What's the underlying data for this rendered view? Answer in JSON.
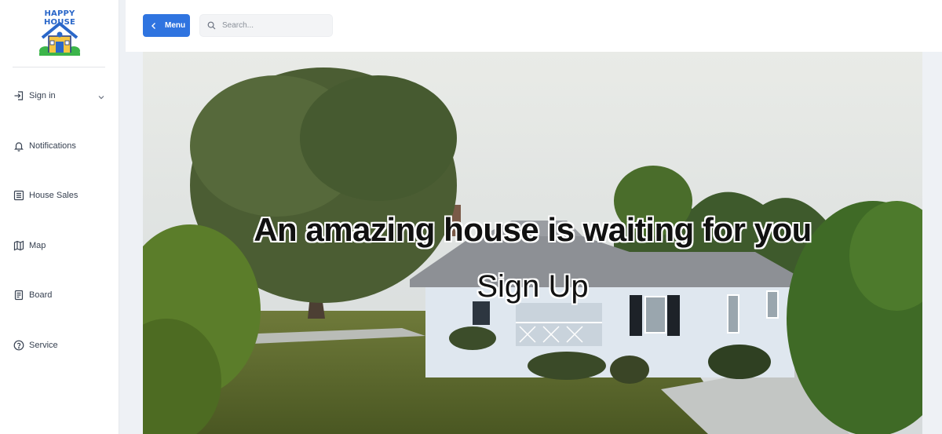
{
  "app": {
    "logo_text": "HAPPY HOUSE"
  },
  "sidebar": {
    "items": [
      {
        "label": "Sign in",
        "icon": "sign-in-icon",
        "has_dropdown": true
      },
      {
        "label": "Notifications",
        "icon": "bell-icon"
      },
      {
        "label": "House Sales",
        "icon": "list-icon"
      },
      {
        "label": "Map",
        "icon": "map-icon"
      },
      {
        "label": "Board",
        "icon": "document-icon"
      },
      {
        "label": "Service",
        "icon": "help-circle-icon"
      }
    ]
  },
  "topbar": {
    "menu_label": "Menu",
    "search_placeholder": "Search..."
  },
  "hero": {
    "title": "An amazing house is waiting for you",
    "cta": "Sign Up"
  },
  "colors": {
    "accent": "#2f74e0",
    "logo_blue": "#2a67c9"
  }
}
